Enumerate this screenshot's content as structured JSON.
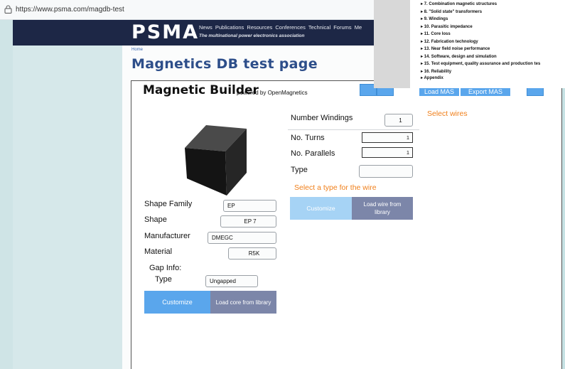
{
  "browser": {
    "url": "https://www.psma.com/magdb-test"
  },
  "site": {
    "logo": "PSMA",
    "nav": [
      "News",
      "Publications",
      "Resources",
      "Conferences",
      "Technical Forums",
      "Me"
    ],
    "tagline": "The multinational power electronics association"
  },
  "breadcrumb": "Home",
  "page_title": "Magnetics DB test page",
  "builder": {
    "title": "Magnetic Builder",
    "subtitle": "powered by OpenMagnetics",
    "load_mas": "Load MAS",
    "export_mas": "Export MAS",
    "select_wires": "Select wires"
  },
  "core": {
    "shape_family_label": "Shape Family",
    "shape_family": "EP",
    "shape_label": "Shape",
    "shape": "EP 7",
    "manufacturer_label": "Manufacturer",
    "manufacturer": "DMEGC",
    "material_label": "Material",
    "material": "R5K",
    "gap_info_label": "Gap Info:",
    "gap_type_label": "Type",
    "gap_type": "Ungapped",
    "customize": "Customize",
    "load_from_library": "Load core from library"
  },
  "winding": {
    "number_windings_label": "Number Windings",
    "number_windings": "1",
    "turns_label": "No. Turns",
    "turns": "1",
    "parallels_label": "No. Parallels",
    "parallels": "1",
    "type_label": "Type",
    "type_value": "",
    "hint": "Select a type for the wire",
    "customize": "Customize",
    "load_from_library": "Load wire from library"
  },
  "toc": [
    "7. Combination magnetic structures",
    "8. \"Solid state\" transformers",
    "9. Windings",
    "10. Parasitic impedance",
    "11. Core loss",
    "12. Fabrication technology",
    "13. Near field noise performance",
    "14. Software, design and simulation",
    "15. Test equipment, quality assurance and production tes",
    "16. Reliability",
    "Appendix"
  ],
  "colors": {
    "header": "#1d2746",
    "title": "#2d4e8a",
    "accent_orange": "#f07f1a",
    "button_blue": "#5aa6ec",
    "button_gray": "#7c86a9"
  }
}
